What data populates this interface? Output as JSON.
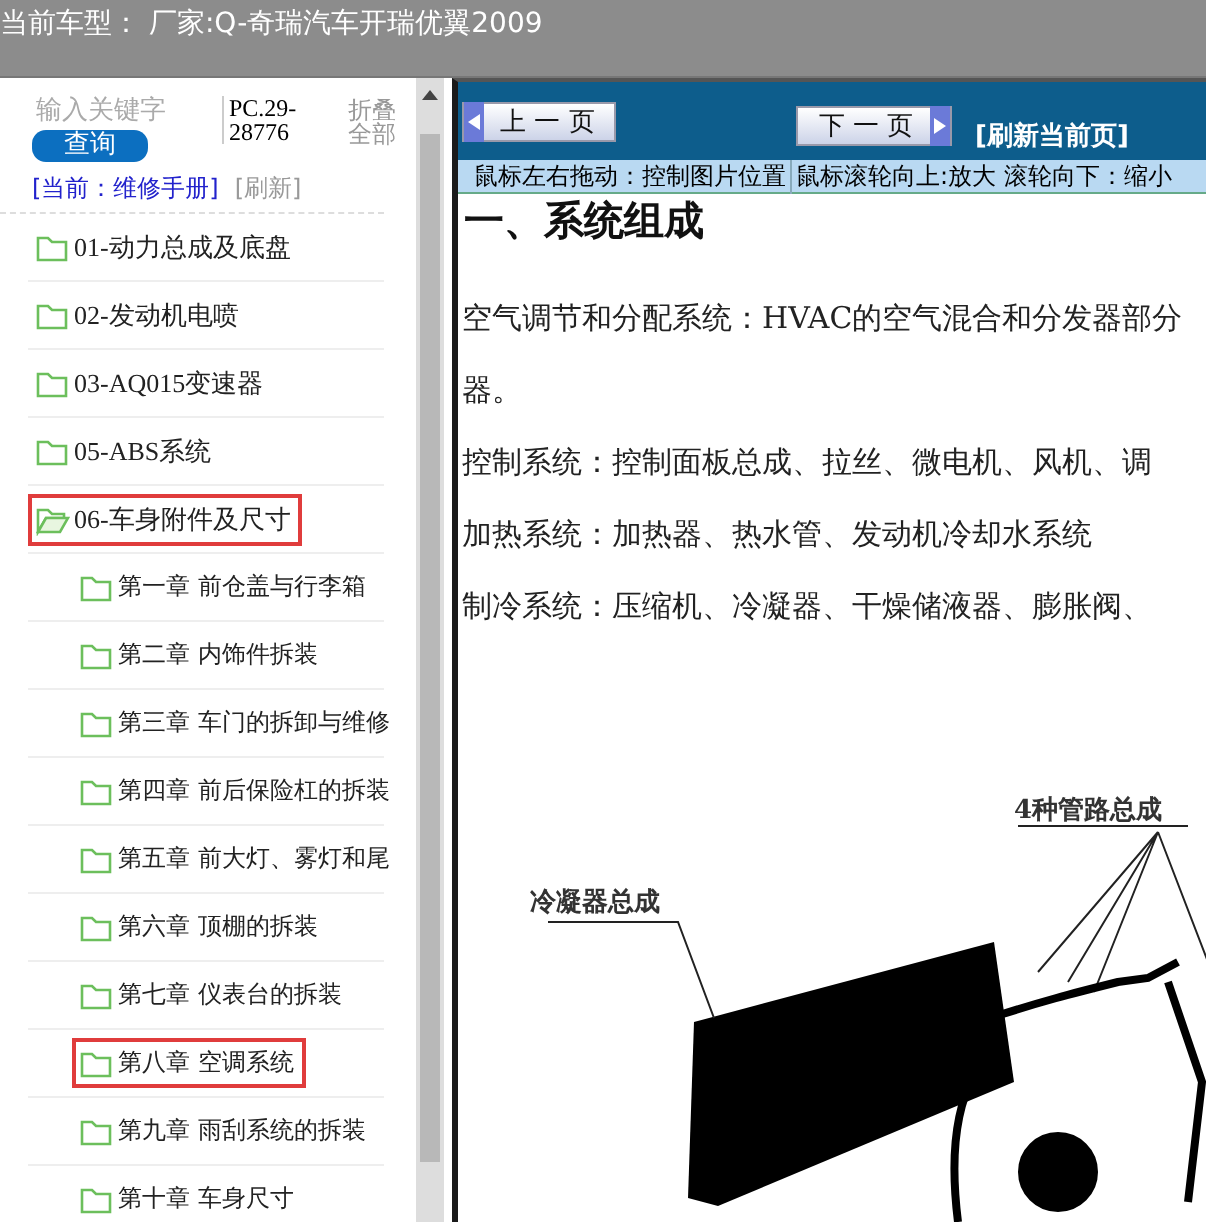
{
  "header": {
    "title": "当前车型： 厂家:Q-奇瑞汽车开瑞优翼2009"
  },
  "sidebar": {
    "search": {
      "placeholder": "输入关键字",
      "button": "查询"
    },
    "code": "PC.29-28776",
    "collapse_all": "折叠全部",
    "current": "[当前：维修手册]",
    "refresh": "[刷新]",
    "tree": [
      {
        "label": "01-动力总成及底盘",
        "expanded": false,
        "selected": false
      },
      {
        "label": "02-发动机电喷",
        "expanded": false,
        "selected": false
      },
      {
        "label": "03-AQ015变速器",
        "expanded": false,
        "selected": false
      },
      {
        "label": "05-ABS系统",
        "expanded": false,
        "selected": false
      },
      {
        "label": "06-车身附件及尺寸",
        "expanded": true,
        "selected": true,
        "children": [
          {
            "label": "第一章 前仓盖与行李箱",
            "selected": false
          },
          {
            "label": "第二章 内饰件拆装",
            "selected": false
          },
          {
            "label": "第三章 车门的拆卸与维修",
            "selected": false
          },
          {
            "label": "第四章 前后保险杠的拆装",
            "selected": false
          },
          {
            "label": "第五章 前大灯、雾灯和尾",
            "selected": false
          },
          {
            "label": "第六章 顶棚的拆装",
            "selected": false
          },
          {
            "label": "第七章 仪表台的拆装",
            "selected": false
          },
          {
            "label": "第八章 空调系统",
            "selected": true
          },
          {
            "label": "第九章 雨刮系统的拆装",
            "selected": false
          },
          {
            "label": "第十章 车身尺寸",
            "selected": false
          }
        ]
      }
    ]
  },
  "viewer": {
    "prev": "上 一 页",
    "next": "下 一 页",
    "refresh": "[刷新当前页]",
    "hints": [
      "鼠标左右拖动：控制图片位置",
      "鼠标滚轮向上:放大  滚轮向下：缩小"
    ],
    "document": {
      "heading": "一、系统组成",
      "paragraphs": [
        "空气调节和分配系统：HVAC的空气混合和分发器部分",
        "器。",
        "控制系统：控制面板总成、拉丝、微电机、风机、调",
        "加热系统：加热器、热水管、发动机冷却水系统",
        "制冷系统：压缩机、冷凝器、干燥储液器、膨胀阀、"
      ],
      "figure": {
        "labels": [
          "冷凝器总成",
          "4种管路总成"
        ]
      }
    }
  }
}
